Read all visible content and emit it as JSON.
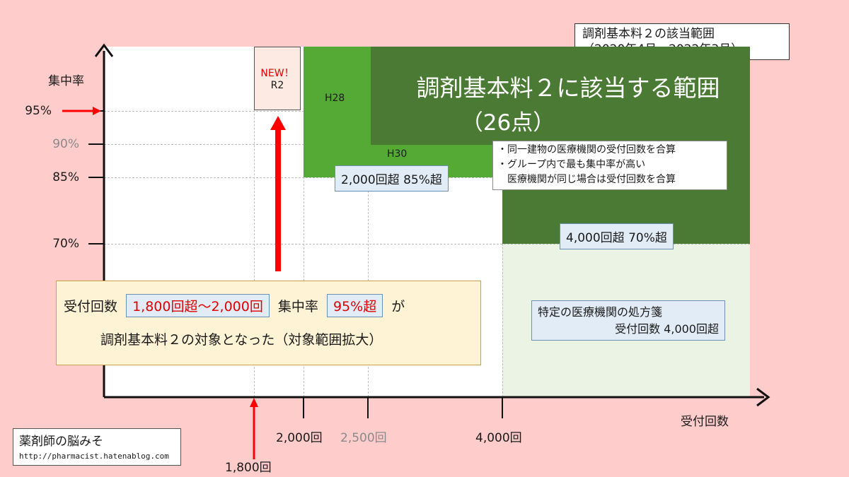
{
  "legend": {
    "line1": "調剤基本料２の該当範囲",
    "line2": "（2020年4月～2022年3月）"
  },
  "axes": {
    "y_title": "集中率",
    "x_title": "受付回数",
    "y_ticks": [
      {
        "label": "95%",
        "color": "#1a1a1a"
      },
      {
        "label": "90%",
        "color": "#8a8a8a"
      },
      {
        "label": "85%",
        "color": "#1a1a1a"
      },
      {
        "label": "70%",
        "color": "#1a1a1a"
      }
    ],
    "x_ticks": [
      {
        "label": "1,800回",
        "color": "#1a1a1a"
      },
      {
        "label": "2,000回",
        "color": "#1a1a1a"
      },
      {
        "label": "2,500回",
        "color": "#8a8a8a"
      },
      {
        "label": "4,000回",
        "color": "#1a1a1a"
      }
    ]
  },
  "regions": {
    "main_title": "調剤基本料２に該当する範囲",
    "main_points": "（26点）",
    "h28": "H28",
    "h30": "H30",
    "new_r2_line1": "NEW！",
    "new_r2_line2": "R2",
    "rule_2000": "2,000回超 85%超",
    "rule_4000": "4,000回超 70%超",
    "notes": [
      "・同一建物の医療機関の受付回数を合算",
      "・グループ内で最も集中率が高い",
      "　医療機関が同じ場合は受付回数を合算"
    ],
    "specific_line1": "特定の医療機関の処方箋",
    "specific_line2": "受付回数 4,000回超"
  },
  "callout": {
    "prefix": "受付回数",
    "range": "1,800回超～2,000回",
    "rate_label": "集中率",
    "rate": "95%超",
    "suffix": "が",
    "line2": "調剤基本料２の対象となった（対象範囲拡大）"
  },
  "credit": {
    "name": "薬剤師の脳みそ",
    "url": "http://pharmacist.hatenablog.com"
  },
  "colors": {
    "background": "#ffcccc",
    "dark_green": "#4a7a33",
    "light_green": "#55aa35",
    "pale_green": "#eaf3e4",
    "red_arrow": "#ff0000"
  }
}
